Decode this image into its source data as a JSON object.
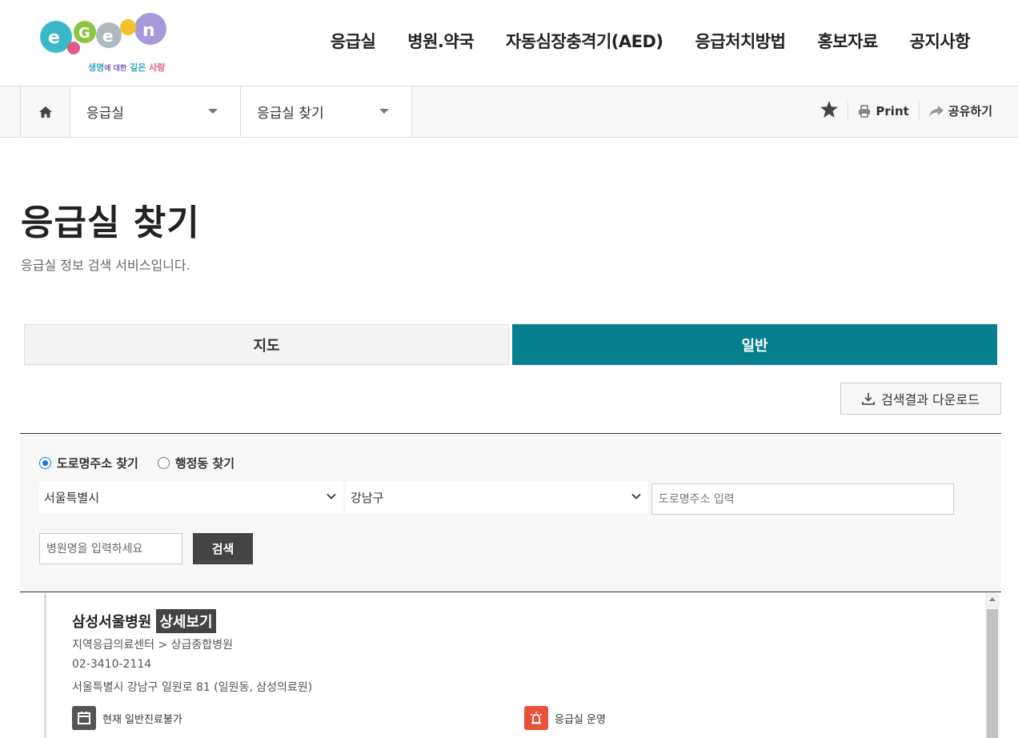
{
  "logo": {
    "text": "e-Gen",
    "tagline_1": "생명",
    "tagline_2": "에 대한",
    "tagline_3": "깊은",
    "tagline_4": "사랑"
  },
  "nav": [
    "응급실",
    "병원.약국",
    "자동심장충격기(AED)",
    "응급처치방법",
    "홍보자료",
    "공지사항"
  ],
  "location": {
    "depth1": "응급실",
    "depth2": "응급실 찾기"
  },
  "utility": {
    "print": "Print",
    "share": "공유하기"
  },
  "page": {
    "title": "응급실 찾기",
    "description": "응급실 정보 검색 서비스입니다."
  },
  "tabs": {
    "map": "지도",
    "general": "일반"
  },
  "download": "검색결과 다운로드",
  "search": {
    "radio_road": "도로명주소 찾기",
    "radio_admin": "행정동 찾기",
    "city": "서울특별시",
    "district": "강남구",
    "road_placeholder": "도로명주소 입력",
    "hospital_placeholder": "병원명을 입력하세요",
    "search_button": "검색"
  },
  "results": [
    {
      "name": "삼성서울병원",
      "detail": "상세보기",
      "category": "지역응급의료센터 > 상급종합병원",
      "phone": "02-3410-2114",
      "address": "서울특별시 강남구 일원로 81 (일원동, 삼성의료원)",
      "status_general": "현재 일반진료불가",
      "status_er": "응급실 운영"
    }
  ],
  "colors": {
    "accent": "#067f8f",
    "dark_button": "#444444",
    "alert": "#e8523a"
  }
}
